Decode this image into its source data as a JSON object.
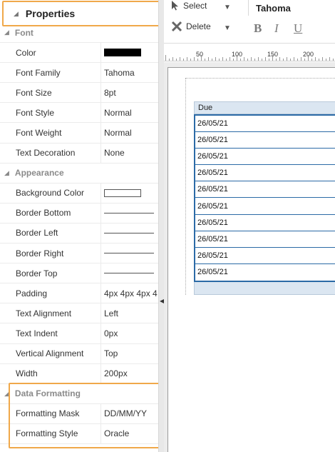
{
  "properties": {
    "title": "Properties",
    "sections": [
      {
        "label": "Font",
        "rows": [
          {
            "key": "Color",
            "type": "swatch",
            "color": "#000000",
            "value": ""
          },
          {
            "key": "Font Family",
            "type": "text",
            "value": "Tahoma"
          },
          {
            "key": "Font Size",
            "type": "text",
            "value": "8pt"
          },
          {
            "key": "Font Style",
            "type": "text",
            "value": "Normal"
          },
          {
            "key": "Font Weight",
            "type": "text",
            "value": "Normal"
          },
          {
            "key": "Text Decoration",
            "type": "text",
            "value": "None"
          }
        ]
      },
      {
        "label": "Appearance",
        "rows": [
          {
            "key": "Background Color",
            "type": "swatch",
            "color": "#ffffff",
            "value": ""
          },
          {
            "key": "Border Bottom",
            "type": "line",
            "value": ""
          },
          {
            "key": "Border Left",
            "type": "line",
            "value": ""
          },
          {
            "key": "Border Right",
            "type": "line",
            "value": ""
          },
          {
            "key": "Border Top",
            "type": "line",
            "value": ""
          },
          {
            "key": "Padding",
            "type": "text",
            "value": "4px 4px 4px 4"
          },
          {
            "key": "Text Alignment",
            "type": "text",
            "value": "Left"
          },
          {
            "key": "Text Indent",
            "type": "text",
            "value": "0px"
          },
          {
            "key": "Vertical Alignment",
            "type": "text",
            "value": "Top"
          },
          {
            "key": "Width",
            "type": "text",
            "value": "200px"
          }
        ]
      },
      {
        "label": "Data Formatting",
        "rows": [
          {
            "key": "Formatting Mask",
            "type": "text",
            "value": "DD/MM/YY"
          },
          {
            "key": "Formatting Style",
            "type": "text",
            "value": "Oracle"
          }
        ]
      }
    ]
  },
  "toolbar": {
    "select_label": "Select",
    "delete_label": "Delete",
    "font_name": "Tahoma",
    "bold": "B",
    "italic": "I",
    "underline": "U"
  },
  "ruler": {
    "ticks": [
      "50",
      "100",
      "150",
      "200"
    ]
  },
  "table": {
    "header": "Due",
    "rows": [
      "26/05/21",
      "26/05/21",
      "26/05/21",
      "26/05/21",
      "26/05/21",
      "26/05/21",
      "26/05/21",
      "26/05/21",
      "26/05/21",
      "26/05/21"
    ]
  },
  "colors": {
    "highlight": "#f0a84a",
    "table_border": "#2b6aa6",
    "table_header_bg": "#dbe6f1"
  }
}
